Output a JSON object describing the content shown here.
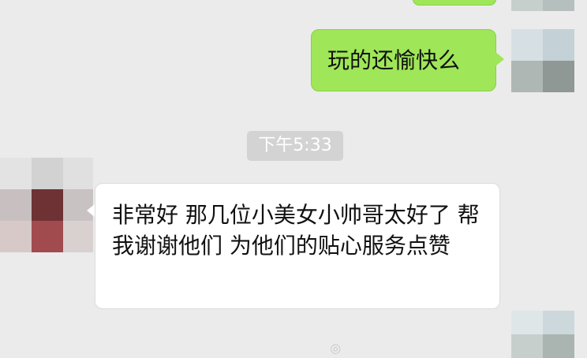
{
  "chat": {
    "messages": [
      {
        "direction": "outgoing",
        "text": "玩的还愉快么"
      },
      {
        "type": "timestamp",
        "text": "下午5:33"
      },
      {
        "direction": "incoming",
        "text": "非常好 那几位小美女小帅哥太好了 帮我谢谢他们 为他们的贴心服务点赞"
      }
    ]
  },
  "colors": {
    "background": "#ebebeb",
    "outgoing_bubble": "#9fe658",
    "incoming_bubble": "#ffffff",
    "timestamp_pill": "#d3d3d3"
  },
  "icons": [
    "user-avatar-blurred",
    "contact-avatar-blurred",
    "watermark-logo"
  ]
}
